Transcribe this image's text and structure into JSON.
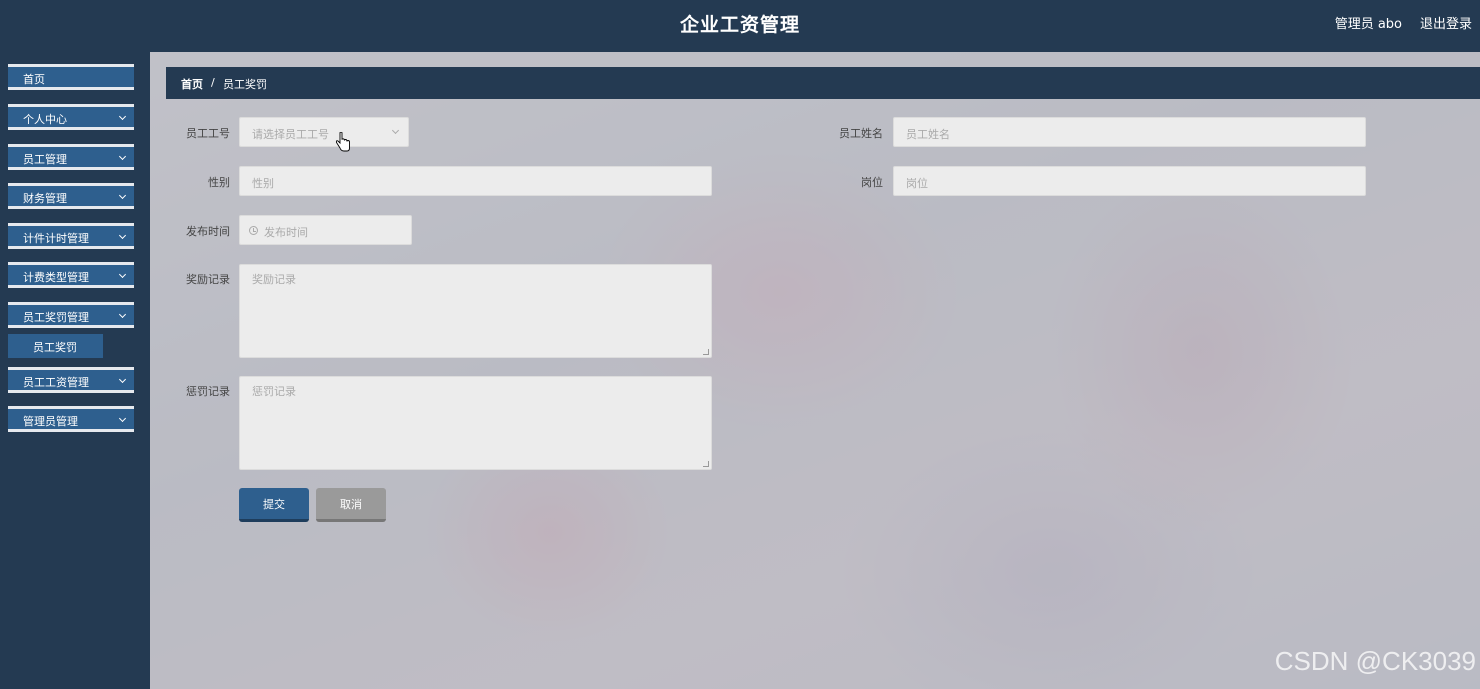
{
  "header": {
    "title": "企业工资管理",
    "user_label": "管理员 abo",
    "logout_label": "退出登录"
  },
  "sidebar": {
    "items": [
      {
        "label": "首页",
        "has_children": false
      },
      {
        "label": "个人中心",
        "has_children": true
      },
      {
        "label": "员工管理",
        "has_children": true
      },
      {
        "label": "财务管理",
        "has_children": true
      },
      {
        "label": "计件计时管理",
        "has_children": true
      },
      {
        "label": "计费类型管理",
        "has_children": true
      },
      {
        "label": "员工奖罚管理",
        "has_children": true
      },
      {
        "label": "员工工资管理",
        "has_children": true
      },
      {
        "label": "管理员管理",
        "has_children": true
      }
    ],
    "active_sub_item": "员工奖罚"
  },
  "breadcrumb": {
    "home": "首页",
    "separator": "/",
    "current": "员工奖罚"
  },
  "form": {
    "employee_no": {
      "label": "员工工号",
      "placeholder": "请选择员工工号",
      "value": ""
    },
    "employee_name": {
      "label": "员工姓名",
      "placeholder": "员工姓名",
      "value": ""
    },
    "gender": {
      "label": "性别",
      "placeholder": "性别",
      "value": ""
    },
    "position": {
      "label": "岗位",
      "placeholder": "岗位",
      "value": ""
    },
    "publish_time": {
      "label": "发布时间",
      "placeholder": "发布时间",
      "value": ""
    },
    "reward_record": {
      "label": "奖励记录",
      "placeholder": "奖励记录",
      "value": ""
    },
    "penalty_record": {
      "label": "惩罚记录",
      "placeholder": "惩罚记录",
      "value": ""
    },
    "submit_label": "提交",
    "cancel_label": "取消"
  },
  "watermark": "CSDN @CK3039",
  "colors": {
    "header_bg": "#243a52",
    "menu_bg": "#2e5f8e",
    "cancel_bg": "#9a9a9a"
  }
}
